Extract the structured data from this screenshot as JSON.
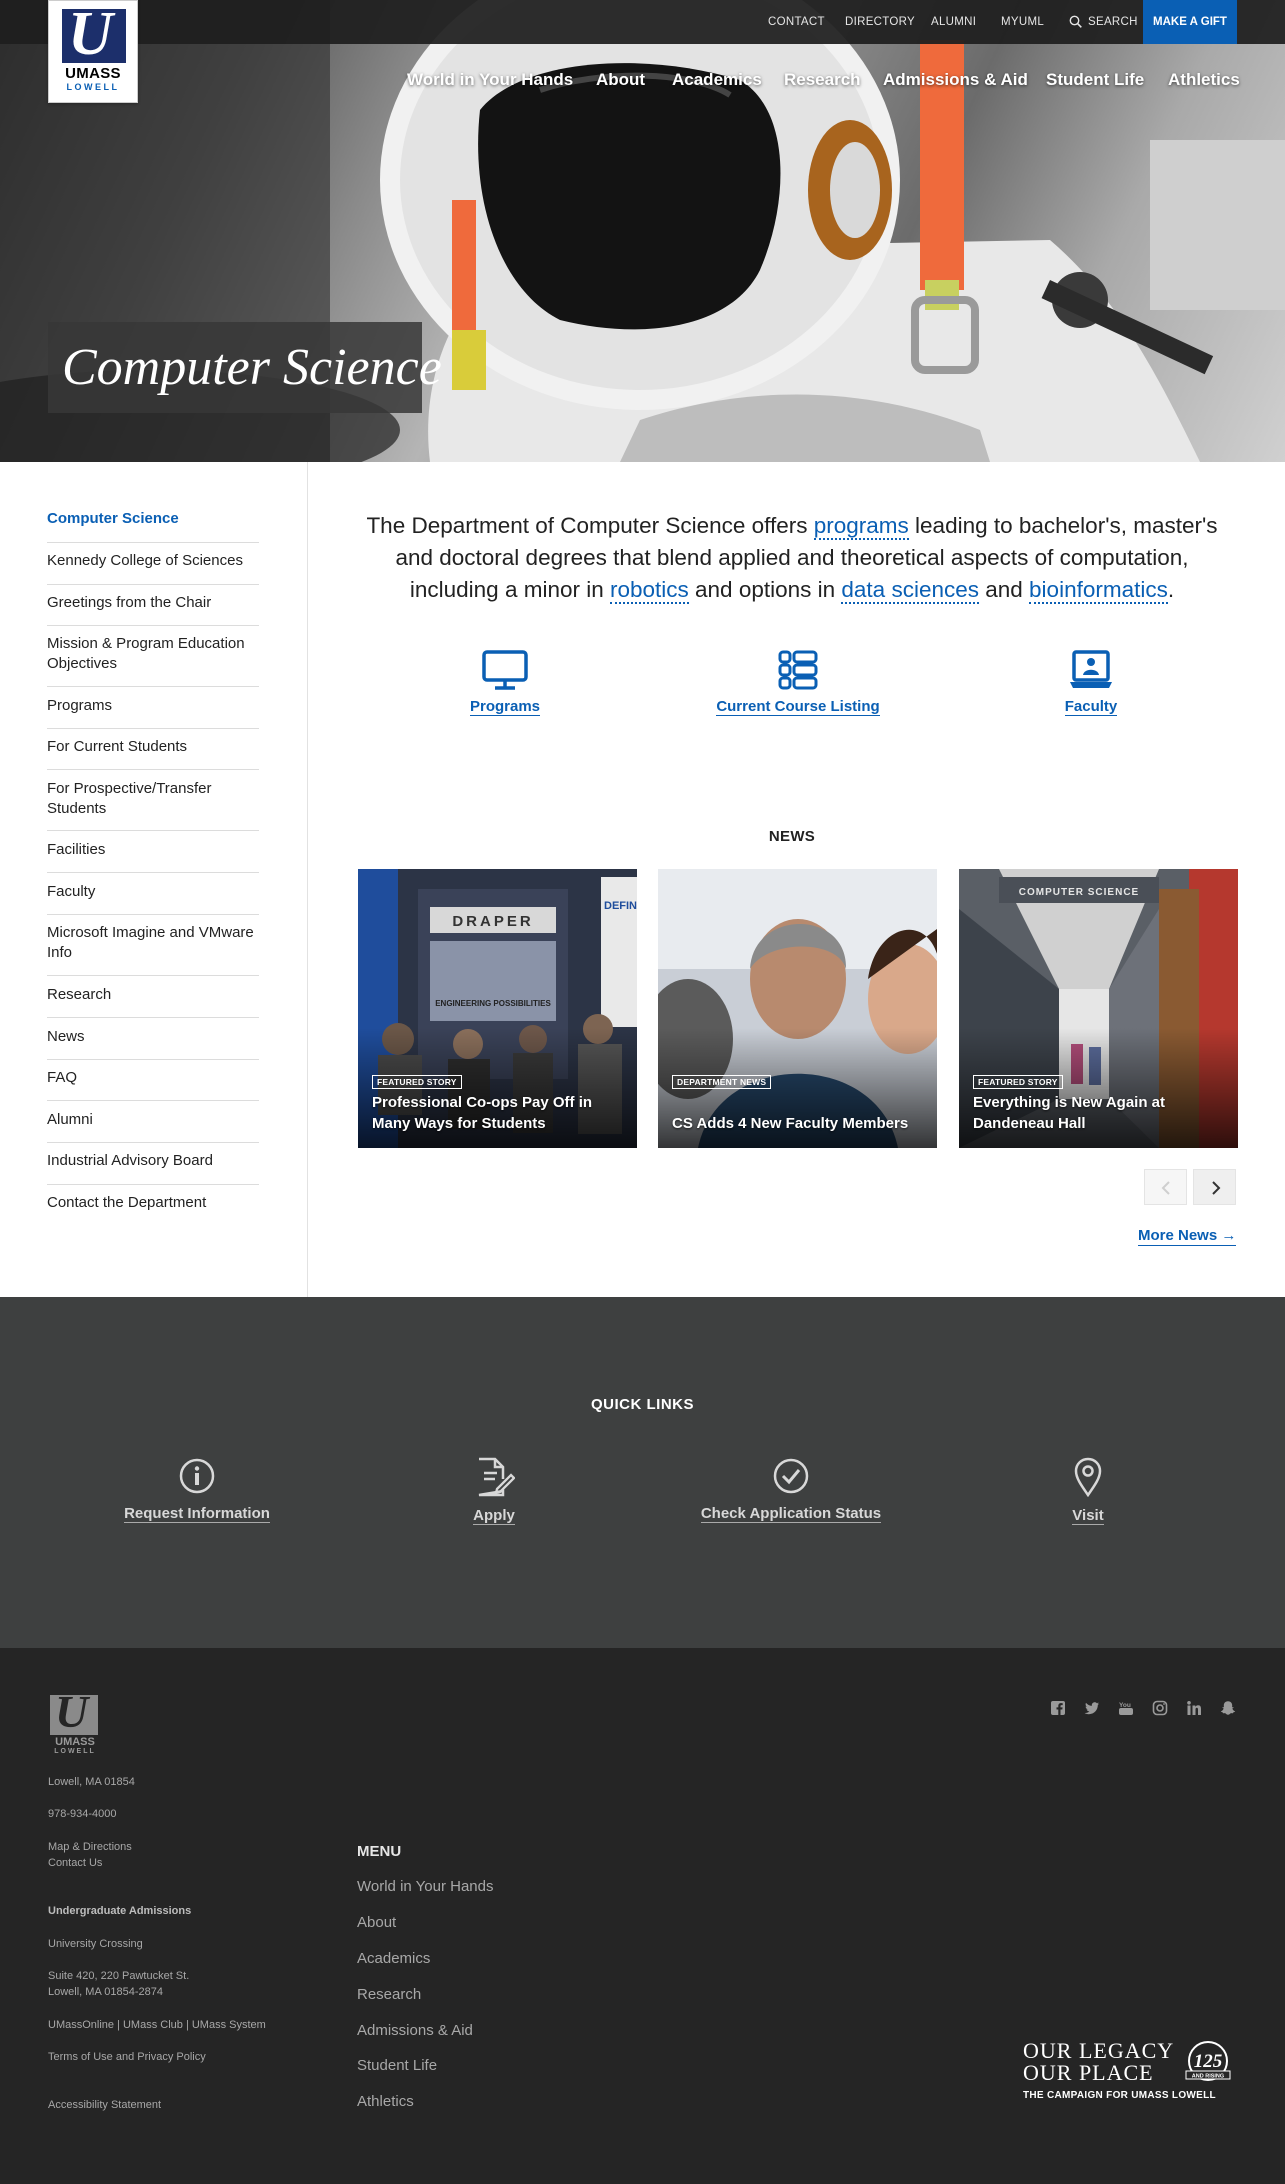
{
  "utility_nav": {
    "contact": "CONTACT",
    "directory": "DIRECTORY",
    "alumni": "ALUMNI",
    "myuml": "MYUML",
    "search": "SEARCH",
    "gift": "MAKE A GIFT"
  },
  "logo": {
    "line1": "UMASS",
    "line2": "LOWELL"
  },
  "main_nav": [
    "World in Your Hands",
    "About",
    "Academics",
    "Research",
    "Admissions & Aid",
    "Student Life",
    "Athletics"
  ],
  "hero": {
    "title": "Computer Science"
  },
  "sidebar": {
    "items": [
      "Computer Science",
      "Kennedy College of Sciences",
      "Greetings from the Chair",
      "Mission & Program Education Objectives",
      "Programs",
      "For Current Students",
      "For Prospective/Transfer Students",
      "Facilities",
      "Faculty",
      "Microsoft Imagine and VMware Info",
      "Research",
      "News",
      "FAQ",
      "Alumni",
      "Industrial Advisory Board",
      "Contact the Department"
    ]
  },
  "intro": {
    "t1": "The Department of Computer Science offers ",
    "l1": "programs",
    "t2": " leading to bachelor's, master's and doctoral degrees that blend applied and theoretical aspects of computation, including a minor in ",
    "l2": "robotics",
    "t3": " and options in ",
    "l3": "data sciences",
    "t4": " and ",
    "l4": "bioinformatics",
    "t5": "."
  },
  "features": [
    {
      "label": "Programs",
      "icon": "monitor-icon"
    },
    {
      "label": "Current Course Listing",
      "icon": "list-icon"
    },
    {
      "label": "Faculty",
      "icon": "laptop-user-icon"
    }
  ],
  "news": {
    "heading": "NEWS",
    "cards": [
      {
        "tag": "FEATURED STORY",
        "title": "Professional Co-ops Pay Off in Many Ways for Students",
        "photo_text_1": "DRAPER",
        "photo_text_2": "ENGINEERING POSSIBILITIES",
        "photo_text_3": "DEFIN HEALT"
      },
      {
        "tag": "DEPARTMENT NEWS",
        "title": "CS Adds 4 New Faculty Members"
      },
      {
        "tag": "FEATURED STORY",
        "title": "Everything is New Again at Dandeneau Hall",
        "photo_text_1": "COMPUTER SCIENCE"
      }
    ],
    "more": "More News →",
    "prev_icon": "chevron-left-icon",
    "next_icon": "chevron-right-icon"
  },
  "quick_links": {
    "heading": "QUICK LINKS",
    "items": [
      {
        "label": "Request Information",
        "icon": "info-icon"
      },
      {
        "label": "Apply",
        "icon": "document-edit-icon"
      },
      {
        "label": "Check Application Status",
        "icon": "check-circle-icon"
      },
      {
        "label": "Visit",
        "icon": "map-pin-icon"
      }
    ]
  },
  "footer": {
    "logo_line1": "UMASS",
    "logo_line2": "LOWELL",
    "city": "Lowell, MA 01854",
    "phone": "978-934-4000",
    "directions": "Map & Directions",
    "contact": "Contact Us",
    "admissions_heading": "Undergraduate Admissions",
    "admissions_building": "University Crossing",
    "address_1": "Suite 420, 220 Pawtucket St.",
    "address_2": "Lowell, MA 01854-2874",
    "systems": "UMassOnline | UMass Club | UMass System",
    "terms": "Terms of Use and Privacy Policy",
    "accessibility": "Accessibility Statement",
    "menu_heading": "MENU",
    "menu": [
      "World in Your Hands",
      "About",
      "Academics",
      "Research",
      "Admissions & Aid",
      "Student Life",
      "Athletics"
    ],
    "social": [
      "facebook-icon",
      "twitter-icon",
      "youtube-icon",
      "instagram-icon",
      "linkedin-icon",
      "snapchat-icon"
    ],
    "campaign_l1": "OUR LEGACY",
    "campaign_l2": "OUR PLACE",
    "campaign_l3": "THE CAMPAIGN FOR UMASS LOWELL",
    "campaign_badge": "125",
    "campaign_badge_sub": "AND RISING"
  },
  "colors": {
    "brand_blue": "#0a5fb4",
    "topbar": "#1e1e1e",
    "quick_links_bg": "#3e4040",
    "footer_bg": "#252525"
  }
}
